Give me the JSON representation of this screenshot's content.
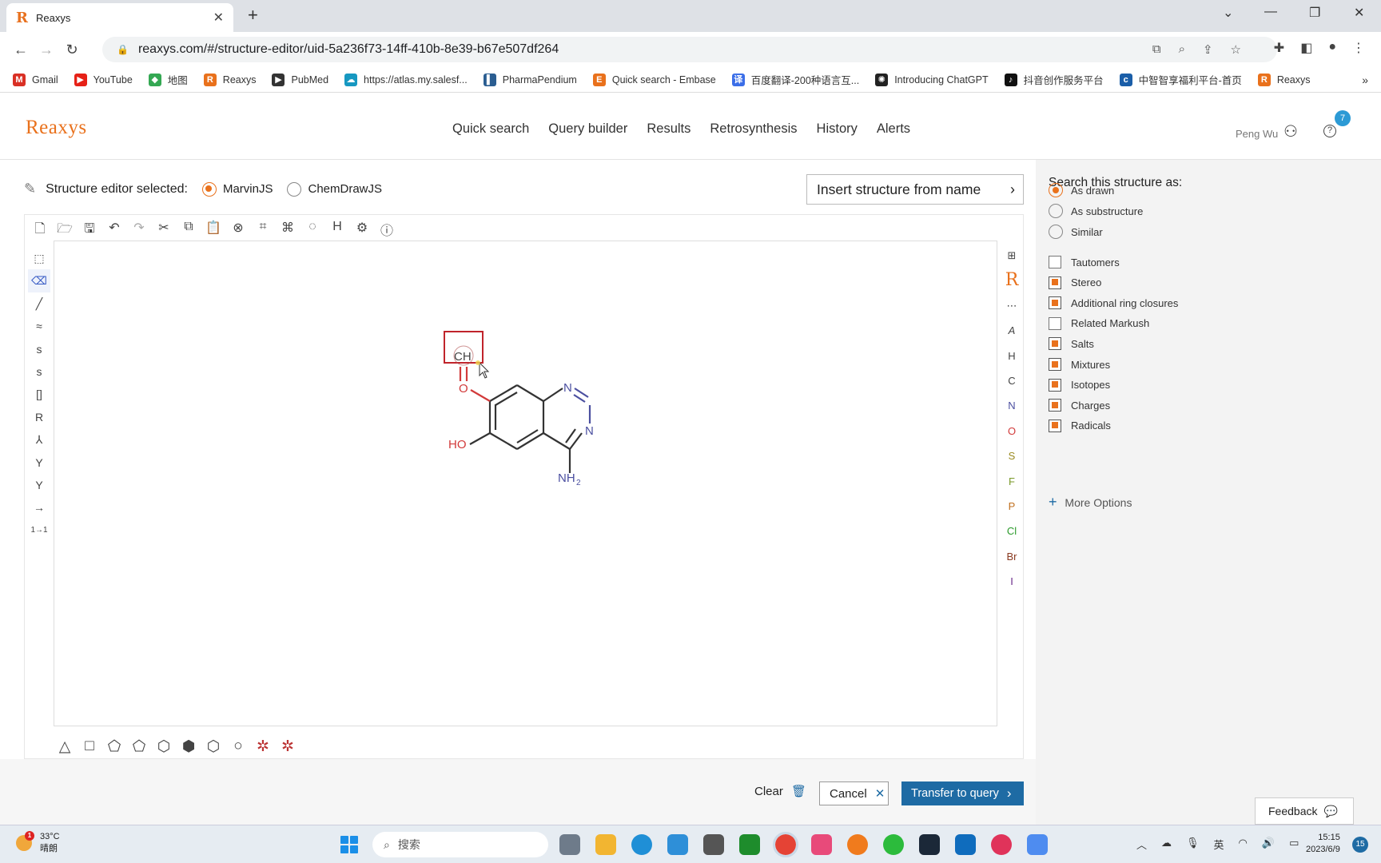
{
  "browser": {
    "tab_title": "Reaxys",
    "tab_favicon": "R",
    "url": "reaxys.com/#/structure-editor/uid-5a236f73-14ff-410b-8e39-b67e507df264"
  },
  "bookmarks": [
    {
      "label": "Gmail",
      "icon": "gmail-icon",
      "color": "#d93025",
      "glyph": "M"
    },
    {
      "label": "YouTube",
      "icon": "youtube-icon",
      "color": "#e62117",
      "glyph": "▶"
    },
    {
      "label": "地图",
      "icon": "maps-icon",
      "color": "#34a853",
      "glyph": "◆"
    },
    {
      "label": "Reaxys",
      "icon": "reaxys-icon",
      "color": "#e9711c",
      "glyph": "R"
    },
    {
      "label": "PubMed",
      "icon": "pubmed-icon",
      "color": "#333333",
      "glyph": "▶"
    },
    {
      "label": "https://atlas.my.salesf...",
      "icon": "salesforce-icon",
      "color": "#1798c1",
      "glyph": "☁"
    },
    {
      "label": "PharmaPendium",
      "icon": "pharmapendium-icon",
      "color": "#2a5d91",
      "glyph": "▌"
    },
    {
      "label": "Quick search - Embase",
      "icon": "embase-icon",
      "color": "#e9711c",
      "glyph": "E"
    },
    {
      "label": "百度翻译-200种语言互...",
      "icon": "baidu-translate-icon",
      "color": "#3b6ee8",
      "glyph": "译"
    },
    {
      "label": "Introducing ChatGPT",
      "icon": "chatgpt-icon",
      "color": "#222222",
      "glyph": "✺"
    },
    {
      "label": "抖音创作服务平台",
      "icon": "douyin-icon",
      "color": "#111111",
      "glyph": "♪"
    },
    {
      "label": "中智智享福利平台-首页",
      "icon": "ciic-icon",
      "color": "#1a5ea8",
      "glyph": "c"
    },
    {
      "label": "Reaxys",
      "icon": "reaxys-icon",
      "color": "#e9711c",
      "glyph": "R"
    }
  ],
  "app": {
    "logo": "Reaxys",
    "nav": [
      "Quick search",
      "Query builder",
      "Results",
      "Retrosynthesis",
      "History",
      "Alerts"
    ],
    "user_name": "Peng Wu",
    "help_badge": "7"
  },
  "editor": {
    "selector_label": "Structure editor selected:",
    "options": [
      {
        "label": "MarvinJS",
        "selected": true
      },
      {
        "label": "ChemDrawJS",
        "selected": false
      }
    ],
    "insert_button": "Insert structure from name",
    "right_atoms": [
      "H",
      "C",
      "N",
      "O",
      "S",
      "F",
      "P",
      "Cl",
      "Br",
      "I"
    ],
    "molecule_labels": {
      "ch": "CH",
      "o": "O",
      "n1": "N",
      "n2": "N",
      "ho": "HO",
      "nh2": "NH",
      "nh2_sub": "2"
    }
  },
  "actions": {
    "clear": "Clear",
    "cancel": "Cancel",
    "transfer": "Transfer to query"
  },
  "panel": {
    "title": "Search this structure as:",
    "search_modes": [
      {
        "label": "As drawn",
        "selected": true
      },
      {
        "label": "As substructure",
        "selected": false
      },
      {
        "label": "Similar",
        "selected": false
      }
    ],
    "checkboxes": [
      {
        "label": "Tautomers",
        "checked": false
      },
      {
        "label": "Stereo",
        "checked": true
      },
      {
        "label": "Additional ring closures",
        "checked": true
      },
      {
        "label": "Related Markush",
        "checked": false
      },
      {
        "label": "Salts",
        "checked": true
      },
      {
        "label": "Mixtures",
        "checked": true
      },
      {
        "label": "Isotopes",
        "checked": true
      },
      {
        "label": "Charges",
        "checked": true
      },
      {
        "label": "Radicals",
        "checked": true
      }
    ],
    "more_options": "More Options",
    "feedback": "Feedback"
  },
  "taskbar": {
    "weather_temp": "33°C",
    "weather_desc": "晴朗",
    "weather_badge": "1",
    "search_placeholder": "搜索",
    "ime": "英",
    "time": "15:15",
    "date": "2023/6/9",
    "notification_count": "15"
  },
  "colors": {
    "accent": "#e9711c",
    "primary_button": "#1e6ba4",
    "panel_bg": "#f3f3f3",
    "atom_nitrogen": "#4b4fa0",
    "atom_oxygen": "#d23a3a"
  }
}
